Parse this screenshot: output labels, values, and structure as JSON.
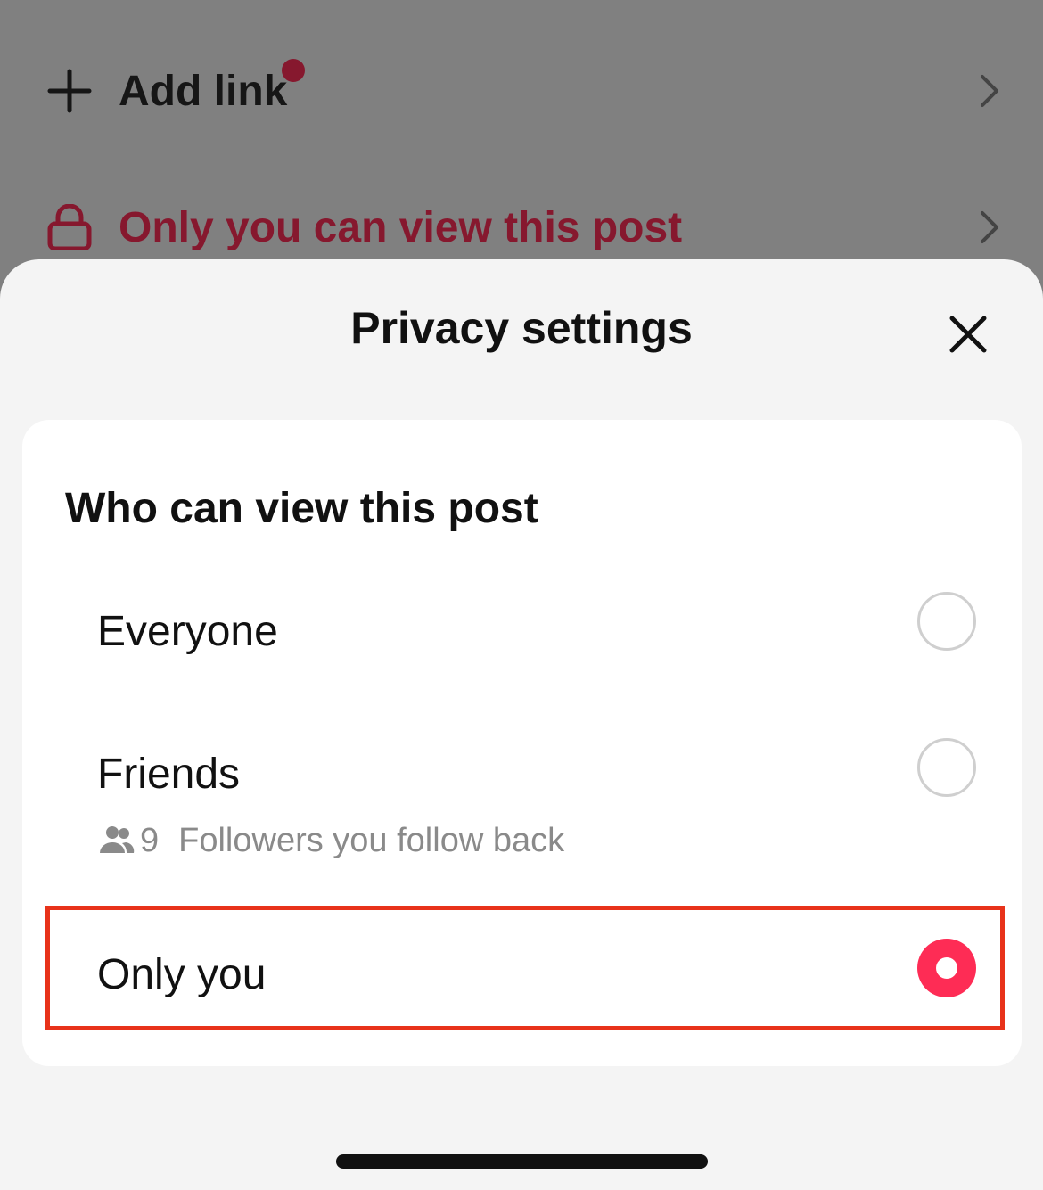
{
  "background_rows": {
    "add_link": {
      "label": "Add link",
      "icon": "plus-icon",
      "has_notification_dot": true
    },
    "privacy": {
      "label": "Only you can view this post",
      "icon": "lock-icon"
    }
  },
  "sheet": {
    "title": "Privacy settings",
    "close_icon": "close-icon",
    "section_heading": "Who can view this post",
    "options": [
      {
        "label": "Everyone",
        "selected": false
      },
      {
        "label": "Friends",
        "selected": false,
        "count": "9",
        "description": "Followers you follow back",
        "icon": "people-icon"
      },
      {
        "label": "Only you",
        "selected": true
      }
    ]
  },
  "colors": {
    "accent": "#fe2c55",
    "highlight_border": "#e8321a",
    "privacy_text": "#86182e",
    "dim_overlay": "#808080"
  }
}
